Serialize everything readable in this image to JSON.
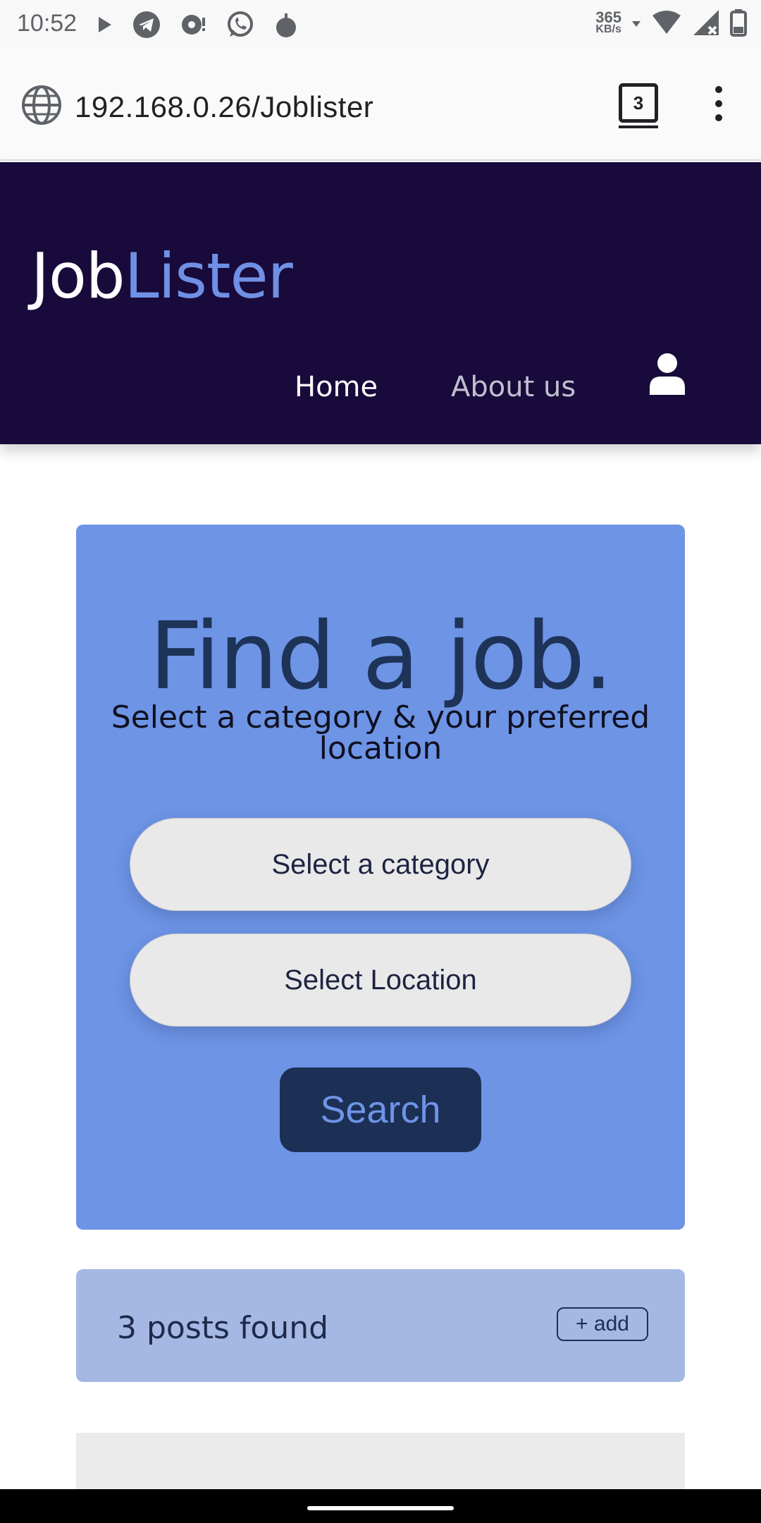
{
  "status_bar": {
    "time": "10:52",
    "net_speed_value": "365",
    "net_speed_unit": "KB/s",
    "left_icons": [
      "play-icon",
      "telegram-icon",
      "notification-icon",
      "whatsapp-icon",
      "bomb-icon"
    ],
    "right_icons": [
      "data-arrows-icon",
      "wifi-icon",
      "signal-icon",
      "battery-icon"
    ]
  },
  "browser": {
    "url": "192.168.0.26/Joblister",
    "tab_count": "3"
  },
  "header": {
    "logo_part1": "Job",
    "logo_part2": "Lister",
    "nav": {
      "home": "Home",
      "about": "About us"
    }
  },
  "search_card": {
    "title": "Find a job.",
    "subtitle": "Select a category & your preferred location",
    "category_select": "Select a category",
    "location_select": "Select Location",
    "search_button": "Search"
  },
  "results": {
    "count_text": "3 posts found",
    "add_button": "+ add"
  },
  "colors": {
    "header_bg": "#180a3a",
    "logo_accent": "#6f90e4",
    "card_bg": "#6d94e5",
    "button_bg": "#1c2f55",
    "results_bg": "#a5b8e4"
  }
}
